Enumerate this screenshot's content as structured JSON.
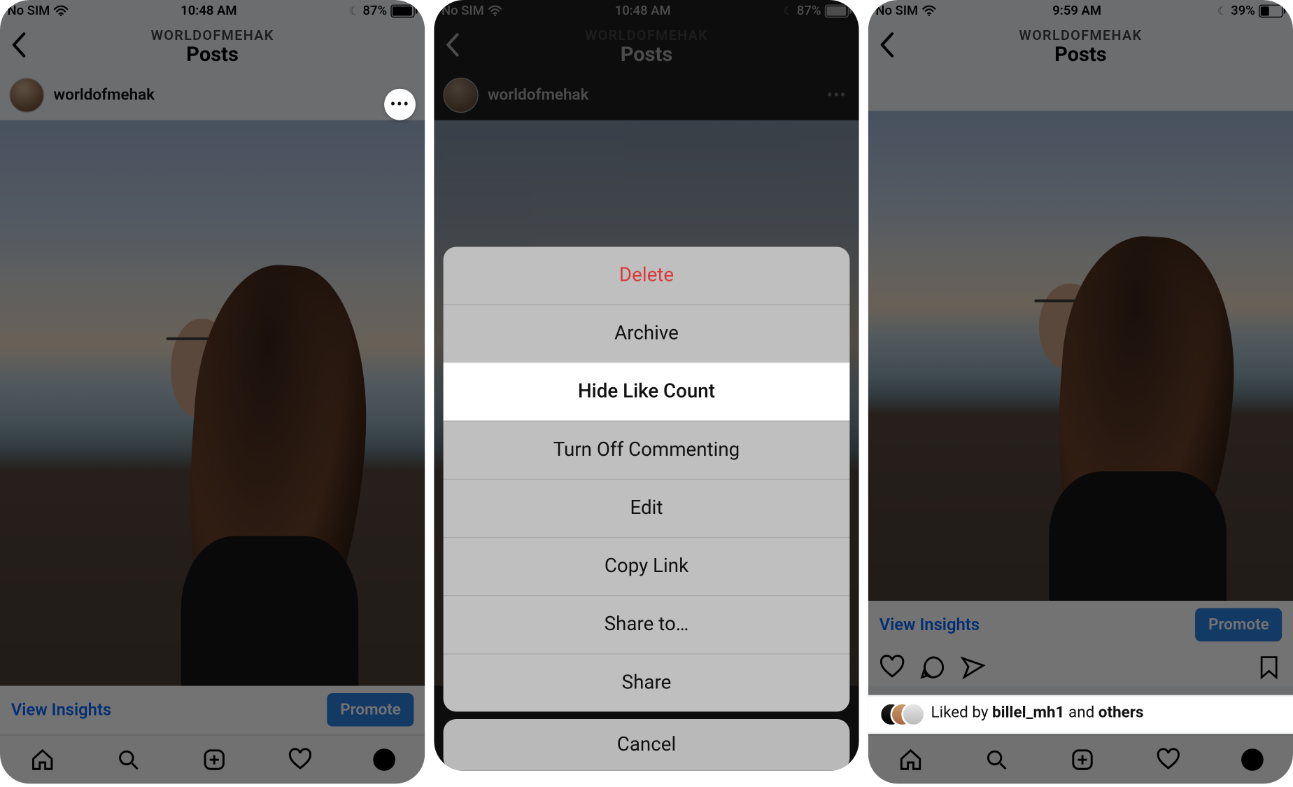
{
  "screens": {
    "a": {
      "status": {
        "carrier": "No SIM",
        "time": "10:48 AM",
        "battery_pct": "87%",
        "battery_fill": 87
      },
      "header": {
        "subtitle": "WORLDOFMEHAK",
        "title": "Posts"
      },
      "post": {
        "username": "worldofmehak"
      },
      "insights": {
        "link": "View Insights",
        "promote": "Promote"
      }
    },
    "b": {
      "status": {
        "carrier": "No SIM",
        "time": "10:48 AM",
        "battery_pct": "87%",
        "battery_fill": 87
      },
      "header": {
        "subtitle": "WORLDOFMEHAK",
        "title": "Posts"
      },
      "post": {
        "username": "worldofmehak"
      },
      "sheet": {
        "items": [
          "Delete",
          "Archive",
          "Hide Like Count",
          "Turn Off Commenting",
          "Edit",
          "Copy Link",
          "Share to…",
          "Share"
        ],
        "highlight_index": 2,
        "danger_index": 0,
        "cancel": "Cancel"
      }
    },
    "c": {
      "status": {
        "carrier": "No SIM",
        "time": "9:59 AM",
        "battery_pct": "39%",
        "battery_fill": 39
      },
      "header": {
        "subtitle": "WORLDOFMEHAK",
        "title": "Posts"
      },
      "post": {
        "username": "worldofmehak"
      },
      "insights": {
        "link": "View Insights",
        "promote": "Promote"
      },
      "liked": {
        "prefix": "Liked by ",
        "name": "billel_mh1",
        "mid": " and ",
        "others": "others"
      }
    }
  }
}
